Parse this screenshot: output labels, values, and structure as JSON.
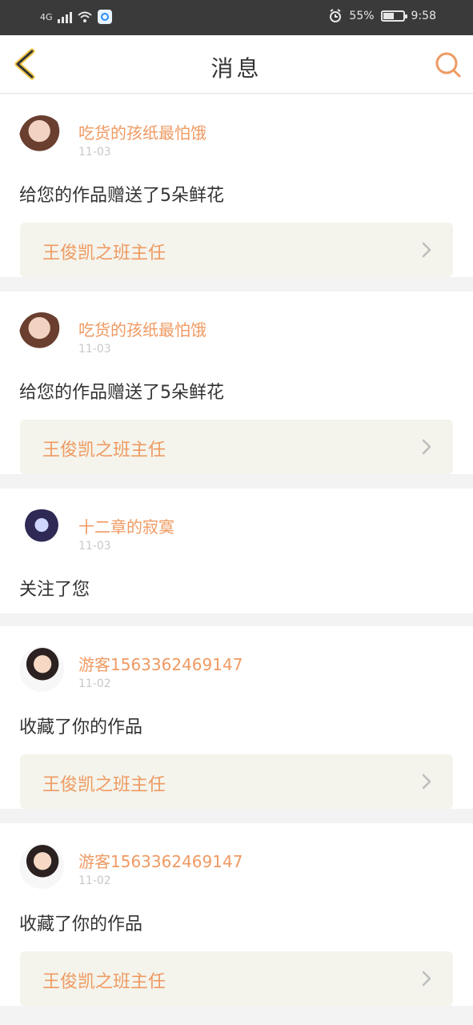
{
  "status_bar": {
    "network": "4G",
    "battery_text": "55%",
    "time": "9:58",
    "battery_level": 0.55
  },
  "nav": {
    "title": "消息"
  },
  "feed": [
    {
      "username": "吃货的孩纸最怕饿",
      "date": "11-03",
      "message": "给您的作品赠送了5朵鲜花",
      "ref_title": "王俊凯之班主任"
    },
    {
      "username": "吃货的孩纸最怕饿",
      "date": "11-03",
      "message": "给您的作品赠送了5朵鲜花",
      "ref_title": "王俊凯之班主任"
    },
    {
      "username": "十二章的寂寞",
      "date": "11-03",
      "message": "关注了您"
    },
    {
      "username": "游客1563362469147",
      "date": "11-02",
      "message": "收藏了你的作品",
      "ref_title": "王俊凯之班主任"
    },
    {
      "username": "游客1563362469147",
      "date": "11-02",
      "message": "收藏了你的作品",
      "ref_title": "王俊凯之班主任"
    }
  ],
  "colors": {
    "accent": "#ef9a62",
    "ref_bg": "#f4f4ec",
    "date": "#c8c8c8"
  },
  "icons": {
    "back": "chevron-left-icon",
    "search": "search-icon",
    "chevron": "chevron-right-icon",
    "alarm": "alarm-icon",
    "wifi": "wifi-icon",
    "signal": "signal-icon"
  }
}
